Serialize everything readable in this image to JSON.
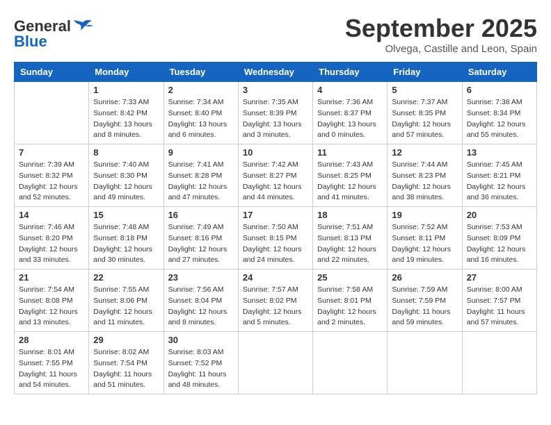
{
  "header": {
    "logo_line1": "General",
    "logo_line2": "Blue",
    "month": "September 2025",
    "location": "Olvega, Castille and Leon, Spain"
  },
  "days_of_week": [
    "Sunday",
    "Monday",
    "Tuesday",
    "Wednesday",
    "Thursday",
    "Friday",
    "Saturday"
  ],
  "weeks": [
    [
      {
        "day": "",
        "info": ""
      },
      {
        "day": "1",
        "info": "Sunrise: 7:33 AM\nSunset: 8:42 PM\nDaylight: 13 hours\nand 8 minutes."
      },
      {
        "day": "2",
        "info": "Sunrise: 7:34 AM\nSunset: 8:40 PM\nDaylight: 13 hours\nand 6 minutes."
      },
      {
        "day": "3",
        "info": "Sunrise: 7:35 AM\nSunset: 8:39 PM\nDaylight: 13 hours\nand 3 minutes."
      },
      {
        "day": "4",
        "info": "Sunrise: 7:36 AM\nSunset: 8:37 PM\nDaylight: 13 hours\nand 0 minutes."
      },
      {
        "day": "5",
        "info": "Sunrise: 7:37 AM\nSunset: 8:35 PM\nDaylight: 12 hours\nand 57 minutes."
      },
      {
        "day": "6",
        "info": "Sunrise: 7:38 AM\nSunset: 8:34 PM\nDaylight: 12 hours\nand 55 minutes."
      }
    ],
    [
      {
        "day": "7",
        "info": "Sunrise: 7:39 AM\nSunset: 8:32 PM\nDaylight: 12 hours\nand 52 minutes."
      },
      {
        "day": "8",
        "info": "Sunrise: 7:40 AM\nSunset: 8:30 PM\nDaylight: 12 hours\nand 49 minutes."
      },
      {
        "day": "9",
        "info": "Sunrise: 7:41 AM\nSunset: 8:28 PM\nDaylight: 12 hours\nand 47 minutes."
      },
      {
        "day": "10",
        "info": "Sunrise: 7:42 AM\nSunset: 8:27 PM\nDaylight: 12 hours\nand 44 minutes."
      },
      {
        "day": "11",
        "info": "Sunrise: 7:43 AM\nSunset: 8:25 PM\nDaylight: 12 hours\nand 41 minutes."
      },
      {
        "day": "12",
        "info": "Sunrise: 7:44 AM\nSunset: 8:23 PM\nDaylight: 12 hours\nand 38 minutes."
      },
      {
        "day": "13",
        "info": "Sunrise: 7:45 AM\nSunset: 8:21 PM\nDaylight: 12 hours\nand 36 minutes."
      }
    ],
    [
      {
        "day": "14",
        "info": "Sunrise: 7:46 AM\nSunset: 8:20 PM\nDaylight: 12 hours\nand 33 minutes."
      },
      {
        "day": "15",
        "info": "Sunrise: 7:48 AM\nSunset: 8:18 PM\nDaylight: 12 hours\nand 30 minutes."
      },
      {
        "day": "16",
        "info": "Sunrise: 7:49 AM\nSunset: 8:16 PM\nDaylight: 12 hours\nand 27 minutes."
      },
      {
        "day": "17",
        "info": "Sunrise: 7:50 AM\nSunset: 8:15 PM\nDaylight: 12 hours\nand 24 minutes."
      },
      {
        "day": "18",
        "info": "Sunrise: 7:51 AM\nSunset: 8:13 PM\nDaylight: 12 hours\nand 22 minutes."
      },
      {
        "day": "19",
        "info": "Sunrise: 7:52 AM\nSunset: 8:11 PM\nDaylight: 12 hours\nand 19 minutes."
      },
      {
        "day": "20",
        "info": "Sunrise: 7:53 AM\nSunset: 8:09 PM\nDaylight: 12 hours\nand 16 minutes."
      }
    ],
    [
      {
        "day": "21",
        "info": "Sunrise: 7:54 AM\nSunset: 8:08 PM\nDaylight: 12 hours\nand 13 minutes."
      },
      {
        "day": "22",
        "info": "Sunrise: 7:55 AM\nSunset: 8:06 PM\nDaylight: 12 hours\nand 11 minutes."
      },
      {
        "day": "23",
        "info": "Sunrise: 7:56 AM\nSunset: 8:04 PM\nDaylight: 12 hours\nand 8 minutes."
      },
      {
        "day": "24",
        "info": "Sunrise: 7:57 AM\nSunset: 8:02 PM\nDaylight: 12 hours\nand 5 minutes."
      },
      {
        "day": "25",
        "info": "Sunrise: 7:58 AM\nSunset: 8:01 PM\nDaylight: 12 hours\nand 2 minutes."
      },
      {
        "day": "26",
        "info": "Sunrise: 7:59 AM\nSunset: 7:59 PM\nDaylight: 11 hours\nand 59 minutes."
      },
      {
        "day": "27",
        "info": "Sunrise: 8:00 AM\nSunset: 7:57 PM\nDaylight: 11 hours\nand 57 minutes."
      }
    ],
    [
      {
        "day": "28",
        "info": "Sunrise: 8:01 AM\nSunset: 7:55 PM\nDaylight: 11 hours\nand 54 minutes."
      },
      {
        "day": "29",
        "info": "Sunrise: 8:02 AM\nSunset: 7:54 PM\nDaylight: 11 hours\nand 51 minutes."
      },
      {
        "day": "30",
        "info": "Sunrise: 8:03 AM\nSunset: 7:52 PM\nDaylight: 11 hours\nand 48 minutes."
      },
      {
        "day": "",
        "info": ""
      },
      {
        "day": "",
        "info": ""
      },
      {
        "day": "",
        "info": ""
      },
      {
        "day": "",
        "info": ""
      }
    ]
  ]
}
